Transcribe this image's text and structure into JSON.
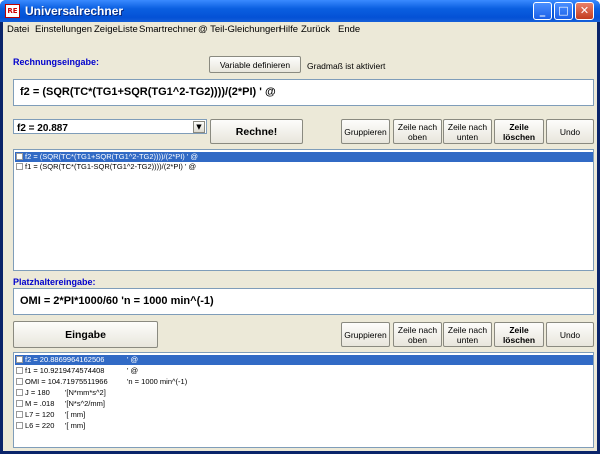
{
  "window": {
    "title": "Universalrechner",
    "icon_text": "RE",
    "minimize": "_",
    "maximize": "□",
    "close": "✕"
  },
  "menu": [
    "Datei",
    "Einstellungen",
    "ZeigeListe",
    "Smartrechner",
    "@ Teil-Gleichungen",
    "Hilfe",
    "Zurück",
    "Ende"
  ],
  "rechnung": {
    "label": "Rechnungseingabe:",
    "variable_button": "Variable definieren",
    "status": "Gradmaß ist aktiviert",
    "input": "f2 = (SQR(TC*(TG1+SQR(TG1^2-TG2))))/(2*PI)  ' @",
    "result": "f2 = 20.887",
    "calc_button": "Rechne!",
    "buttons": {
      "group": "Gruppieren",
      "up": "Zeile nach oben",
      "down": "Zeile nach unten",
      "delete": "Zeile löschen",
      "undo": "Undo"
    },
    "list": [
      {
        "text": "f2 = (SQR(TC*(TG1+SQR(TG1^2-TG2))))/(2*PI)  ' @",
        "selected": true
      },
      {
        "text": "f1 = (SQR(TC*(TG1-SQR(TG1^2-TG2))))/(2*PI)  ' @",
        "selected": false
      }
    ]
  },
  "platzhalter": {
    "label": "Platzhaltereingabe:",
    "input": "OMI = 2*PI*1000/60    'n = 1000 min^(-1)",
    "enter_button": "Eingabe",
    "buttons": {
      "group": "Gruppieren",
      "up": "Zeile nach oben",
      "down": "Zeile nach unten",
      "delete": "Zeile löschen",
      "undo": "Undo"
    },
    "list": [
      {
        "value": "f2 = 20.8869964162506",
        "comment": "' @",
        "selected": true
      },
      {
        "value": "f1 = 10.9219474574408",
        "comment": "' @",
        "selected": false
      },
      {
        "value": "OMI = 104.71975511966",
        "comment": "'n = 1000 min^(-1)",
        "selected": false
      },
      {
        "value": "J = 180",
        "comment": "'[N*mm*s^2]",
        "selected": false
      },
      {
        "value": "M = .018",
        "comment": "'[N*s^2/mm]",
        "selected": false
      },
      {
        "value": "L7 = 120",
        "comment": "'[ mm]",
        "selected": false
      },
      {
        "value": "L6 = 220",
        "comment": "'[ mm]",
        "selected": false
      }
    ]
  },
  "colors": {
    "title_bar": "#0451d6",
    "selection": "#316ac5",
    "label_blue": "#0000cc",
    "face": "#ece9d8"
  }
}
